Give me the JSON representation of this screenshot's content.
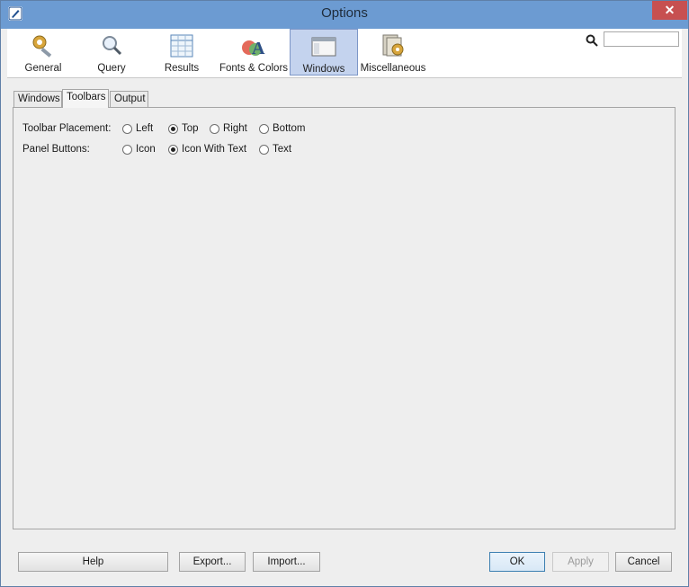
{
  "window": {
    "title": "Options"
  },
  "toolbar": {
    "items": [
      {
        "label": "General",
        "icon": "gear-wrench-icon"
      },
      {
        "label": "Query",
        "icon": "magnifier-icon"
      },
      {
        "label": "Results",
        "icon": "table-icon"
      },
      {
        "label": "Fonts & Colors",
        "icon": "font-color-icon"
      },
      {
        "label": "Windows",
        "icon": "window-icon",
        "selected": true
      },
      {
        "label": "Miscellaneous",
        "icon": "misc-gear-icon"
      }
    ],
    "search": {
      "placeholder": "",
      "value": ""
    }
  },
  "tabs": [
    {
      "label": "Windows"
    },
    {
      "label": "Toolbars",
      "active": true
    },
    {
      "label": "Output"
    }
  ],
  "panel": {
    "placement": {
      "label": "Toolbar Placement:",
      "options": [
        "Left",
        "Top",
        "Right",
        "Bottom"
      ],
      "selected": "Top"
    },
    "buttons": {
      "label": "Panel Buttons:",
      "options": [
        "Icon",
        "Icon With Text",
        "Text"
      ],
      "selected": "Icon With Text"
    }
  },
  "footer": {
    "help": "Help",
    "export": "Export...",
    "import": "Import...",
    "ok": "OK",
    "apply": "Apply",
    "cancel": "Cancel"
  },
  "colors": {
    "titlebar": "#6c9bd2",
    "selected_tab_bg": "#c4d3ee",
    "close_button": "#c75050"
  }
}
